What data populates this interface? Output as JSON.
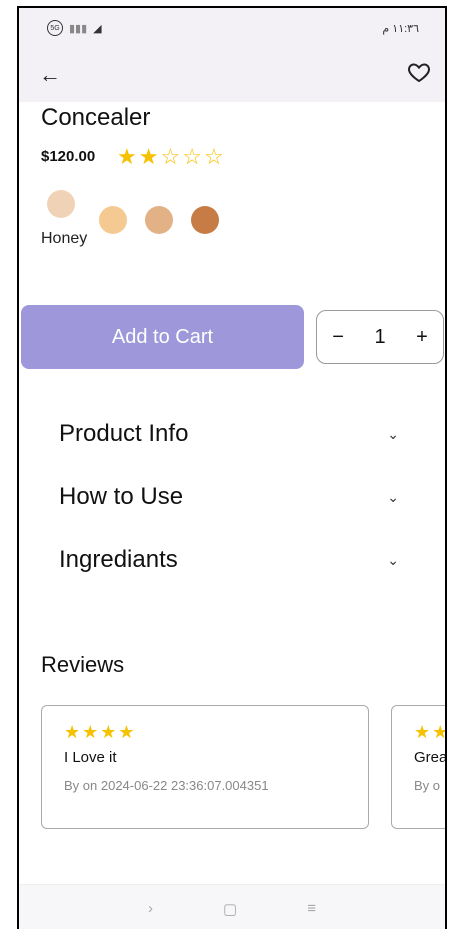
{
  "status": {
    "time": "١١:٣٦ م",
    "icons": [
      "5G",
      "signal",
      "wifi"
    ]
  },
  "appbar": {
    "back": "←",
    "favorite": "heart-icon"
  },
  "product": {
    "title": "Concealer",
    "price": "$120.00",
    "rating": 2,
    "rating_max": 5,
    "stars": [
      "★",
      "★",
      "☆",
      "☆",
      "☆"
    ],
    "selected_shade": "Honey",
    "shades": [
      {
        "color": "#f0d3b7"
      },
      {
        "color": "#f5c992"
      },
      {
        "color": "#e2b185"
      },
      {
        "color": "#c77b45"
      }
    ]
  },
  "cart": {
    "button": "Add to Cart"
  },
  "stepper": {
    "minus": "−",
    "qty": "1",
    "plus": "+"
  },
  "sections": [
    {
      "label": "Product Info",
      "chevron": "⌄"
    },
    {
      "label": "How to Use",
      "chevron": "⌄"
    },
    {
      "label": "Ingrediants",
      "chevron": "⌄"
    }
  ],
  "reviews": {
    "title": "Reviews",
    "items": [
      {
        "stars": "★★★★",
        "text": "I Love it",
        "meta": "By  on 2024-06-22 23:36:07.004351"
      },
      {
        "stars": "★★",
        "text": "Grea",
        "meta": "By  o"
      }
    ]
  },
  "navbar": {
    "back": "›",
    "home": "▢",
    "menu": "≡"
  }
}
